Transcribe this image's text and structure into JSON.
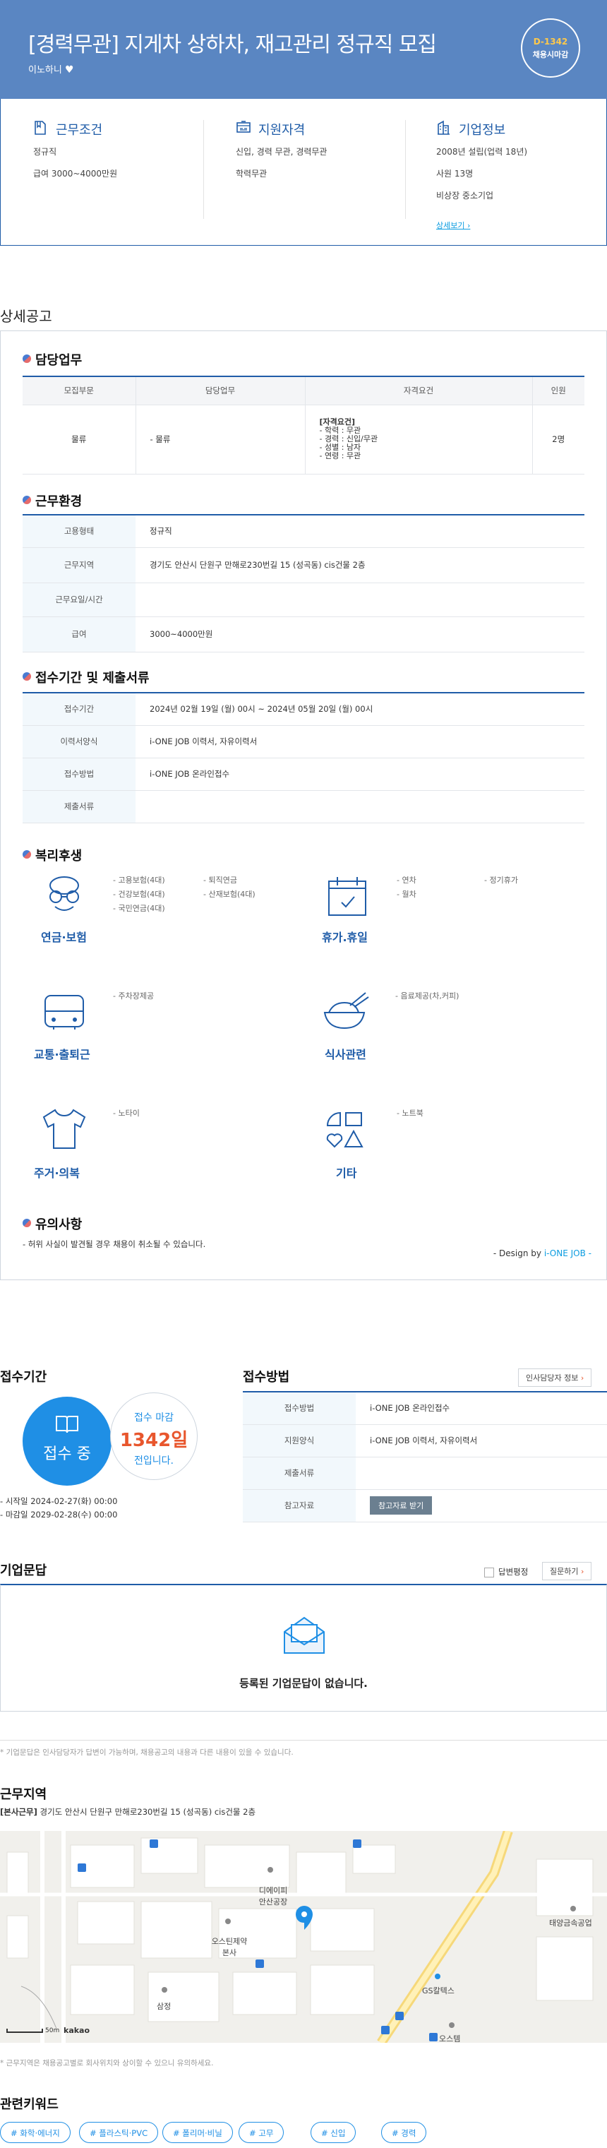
{
  "header": {
    "title": "[경력무관] 지게차 상하차, 재고관리 정규직 모집",
    "company": "이노하니",
    "dday": "D-1342",
    "dday_sub": "채용시마감"
  },
  "info": {
    "conditions": {
      "title": "근무조건",
      "items": [
        "정규직",
        "급여 3000~4000만원"
      ]
    },
    "qualification": {
      "title": "지원자격",
      "items": [
        "신입, 경력 무관, 경력무관",
        "학력무관"
      ]
    },
    "company": {
      "title": "기업정보",
      "items": [
        "2008년 설립(업력 18년)",
        "사원 13명",
        "비상장 중소기업"
      ],
      "more": "상세보기"
    }
  },
  "detail_title": "상세공고",
  "duty": {
    "title": "담당업무",
    "headers": [
      "모집부문",
      "담당업무",
      "자격요건",
      "인원"
    ],
    "row": {
      "part": "물류",
      "task": "- 물류",
      "req_title": "[자격요건]",
      "req": [
        "- 학력 : 무관",
        "- 경력 : 신입/무관",
        "- 성별 : 남자",
        "- 연령 : 무관"
      ],
      "count": "2명"
    }
  },
  "env": {
    "title": "근무환경",
    "rows": [
      {
        "k": "고용형태",
        "v": "정규직"
      },
      {
        "k": "근무지역",
        "v": "경기도 안산시 단원구 만해로230번길 15 (성곡동) cis건물 2층"
      },
      {
        "k": "근무요일/시간",
        "v": ""
      },
      {
        "k": "급여",
        "v": "3000~4000만원"
      }
    ]
  },
  "submit": {
    "title": "접수기간 및 제출서류",
    "rows": [
      {
        "k": "접수기간",
        "v": "2024년 02월 19일 (월) 00시 ~ 2024년 05월 20일 (월) 00시"
      },
      {
        "k": "이력서양식",
        "v": "i-ONE JOB 이력서, 자유이력서"
      },
      {
        "k": "접수방법",
        "v": "i-ONE JOB 온라인접수"
      },
      {
        "k": "제출서류",
        "v": ""
      }
    ]
  },
  "welfare": {
    "title": "복리후생",
    "pension": {
      "label": "연금·보험",
      "items": [
        "- 고용보험(4대)",
        "- 퇴직연금",
        "- 건강보험(4대)",
        "- 산재보험(4대)",
        "- 국민연금(4대)"
      ]
    },
    "vacation": {
      "label": "휴가.휴일",
      "items": [
        "- 연차",
        "- 정기휴가",
        "- 월차"
      ]
    },
    "commute": {
      "label": "교통·출퇴근",
      "items": [
        "- 주차장제공"
      ]
    },
    "meal": {
      "label": "식사관련",
      "items": [
        "- 음료제공(차,커피)"
      ]
    },
    "housing": {
      "label": "주거·의복",
      "items": [
        "- 노타이"
      ]
    },
    "etc": {
      "label": "기타",
      "items": [
        "- 노트북"
      ]
    }
  },
  "notice": {
    "title": "유의사항",
    "text": "- 허위 사실이 발견될 경우 채용이 취소될 수 있습니다.",
    "design_prefix": "- Design by ",
    "design_brand": "i-ONE JOB -"
  },
  "apply_period": {
    "title": "접수기간",
    "status": "접수 중",
    "deadline_label": "접수 마감",
    "days": "1342일",
    "days_suffix": "전입니다.",
    "start": "시작일 2024-02-27(화) 00:00",
    "end": "마감일 2029-02-28(수) 00:00"
  },
  "apply_method": {
    "title": "접수방법",
    "contact_btn": "인사담당자 정보",
    "rows": [
      {
        "k": "접수방법",
        "v": "i-ONE JOB 온라인접수"
      },
      {
        "k": "지원양식",
        "v": "i-ONE JOB 이력서, 자유이력서"
      },
      {
        "k": "제출서류",
        "v": ""
      },
      {
        "k": "참고자료",
        "v": ""
      }
    ],
    "ref_btn": "참고자료 받기"
  },
  "qna": {
    "title": "기업문답",
    "check_label": "답변평정",
    "ask_btn": "질문하기",
    "empty": "등록된 기업문답이 없습니다.",
    "note": "* 기업문답은 인사담당자가 답변이 가능하며, 채용공고의 내용과 다른 내용이 있을 수 있습니다."
  },
  "location": {
    "title": "근무지역",
    "tag": "[본사근무]",
    "address": "경기도 안산시 단원구 만해로230번길 15 (성곡동) cis건물 2층",
    "map_labels": [
      "디에이피 안산공장",
      "오스틴제약 본사",
      "삼정",
      "태양금속공업",
      "GS칼텍스",
      "오스템"
    ],
    "scale": "50m",
    "brand": "kakao",
    "note": "* 근무지역은 채용공고별로 회사위치와 상이할 수 있으니 유의하세요."
  },
  "keywords": {
    "title": "관련키워드",
    "items": [
      "# 화학·에너지",
      "# 플라스틱·PVC",
      "# 폴리머·비닐",
      "# 고무",
      "# 신입",
      "# 경력"
    ]
  }
}
